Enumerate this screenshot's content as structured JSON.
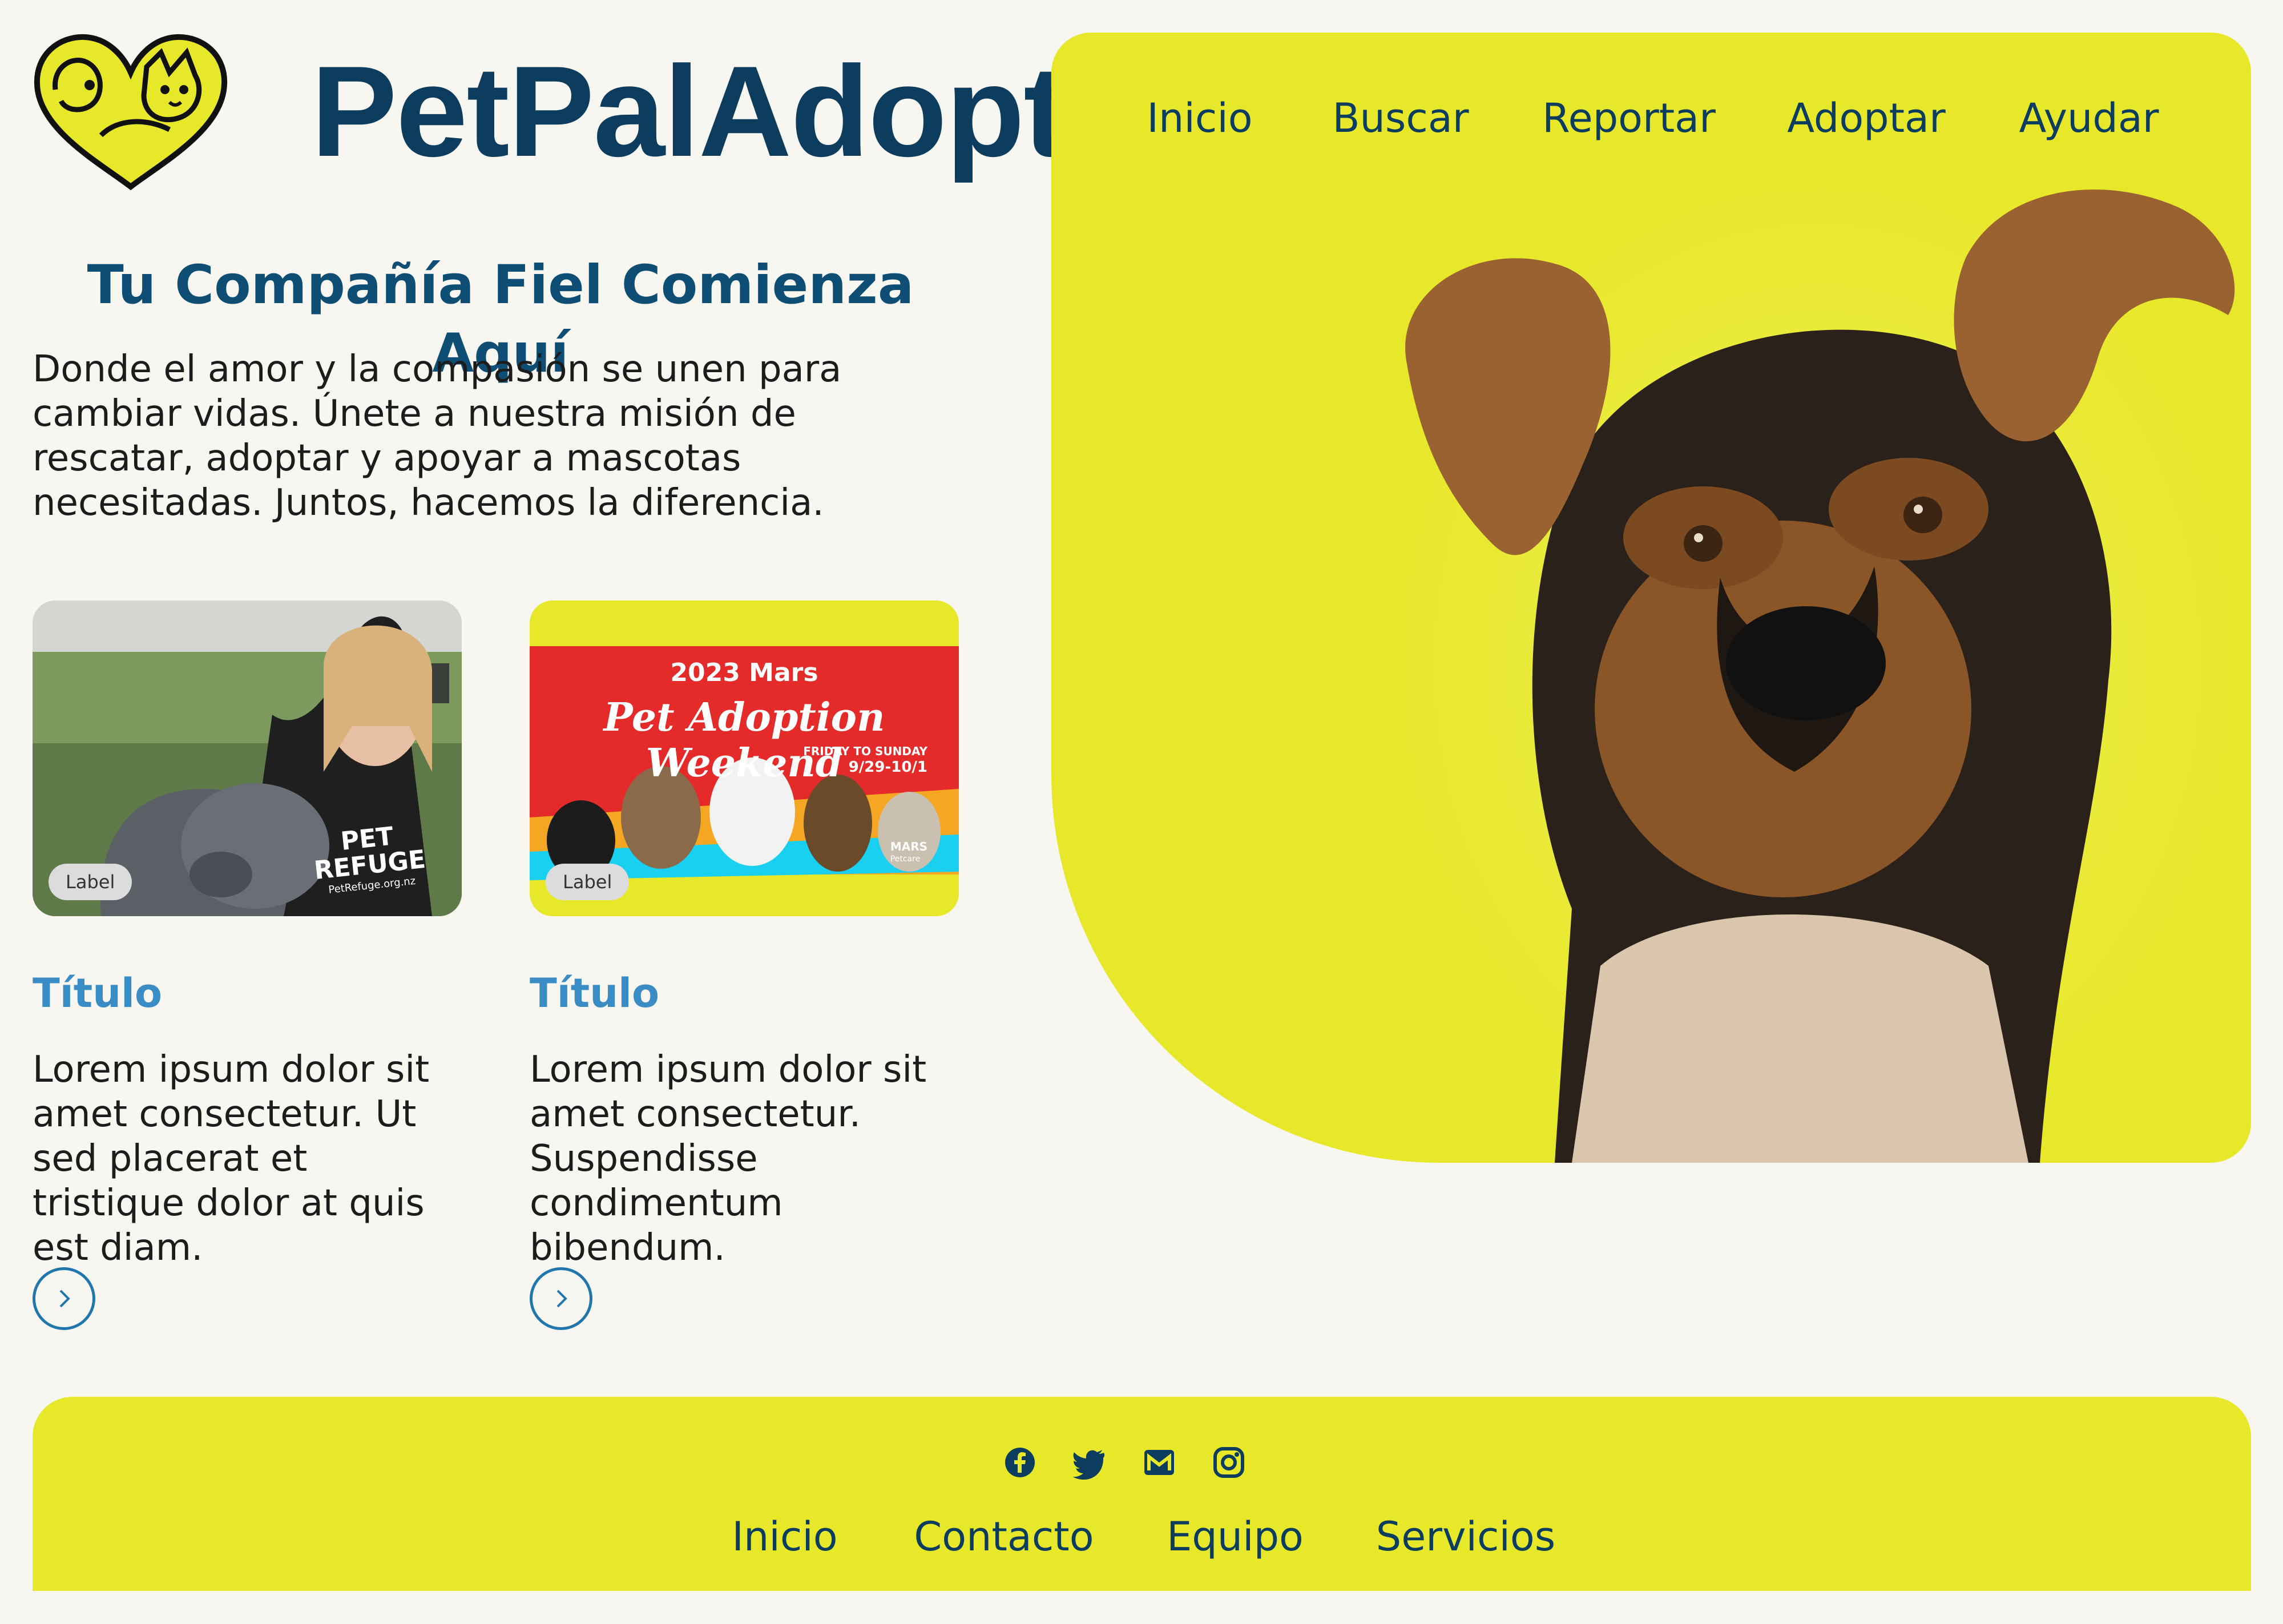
{
  "brand": {
    "name": "PetPalAdopt"
  },
  "nav": {
    "items": [
      "Inicio",
      "Buscar",
      "Reportar",
      "Adoptar",
      "Ayudar"
    ]
  },
  "hero": {
    "title": "Tu Compañía Fiel Comienza Aquí",
    "description": "Donde el amor y la compasión se unen para cambiar vidas. Únete a nuestra misión de rescatar, adoptar y apoyar a mascotas necesitadas. Juntos, hacemos la diferencia."
  },
  "cards": [
    {
      "label": "Label",
      "title": "Título",
      "text": "Lorem ipsum dolor sit amet consectetur. Ut sed placerat et tristique dolor at quis est diam.",
      "image_text": [
        "PET",
        "REFUGE",
        "PetRefuge.org.nz"
      ]
    },
    {
      "label": "Label",
      "title": "Título",
      "text": "Lorem ipsum dolor sit amet consectetur. Suspendisse condimentum bibendum.",
      "image_text": [
        "2023 Mars",
        "Pet Adoption Weekend",
        "FRIDAY TO SUNDAY",
        "9/29-10/1",
        "MARS",
        "Petcare"
      ]
    }
  ],
  "footer": {
    "social": [
      "facebook-icon",
      "twitter-icon",
      "gmail-icon",
      "instagram-icon"
    ],
    "links": [
      "Inicio",
      "Contacto",
      "Equipo",
      "Servicios"
    ]
  },
  "colors": {
    "background": "#f8f6f1",
    "accent_yellow": "#e8e82a",
    "brand_navy": "#0c3d5e",
    "title_blue": "#3a8cc4"
  }
}
